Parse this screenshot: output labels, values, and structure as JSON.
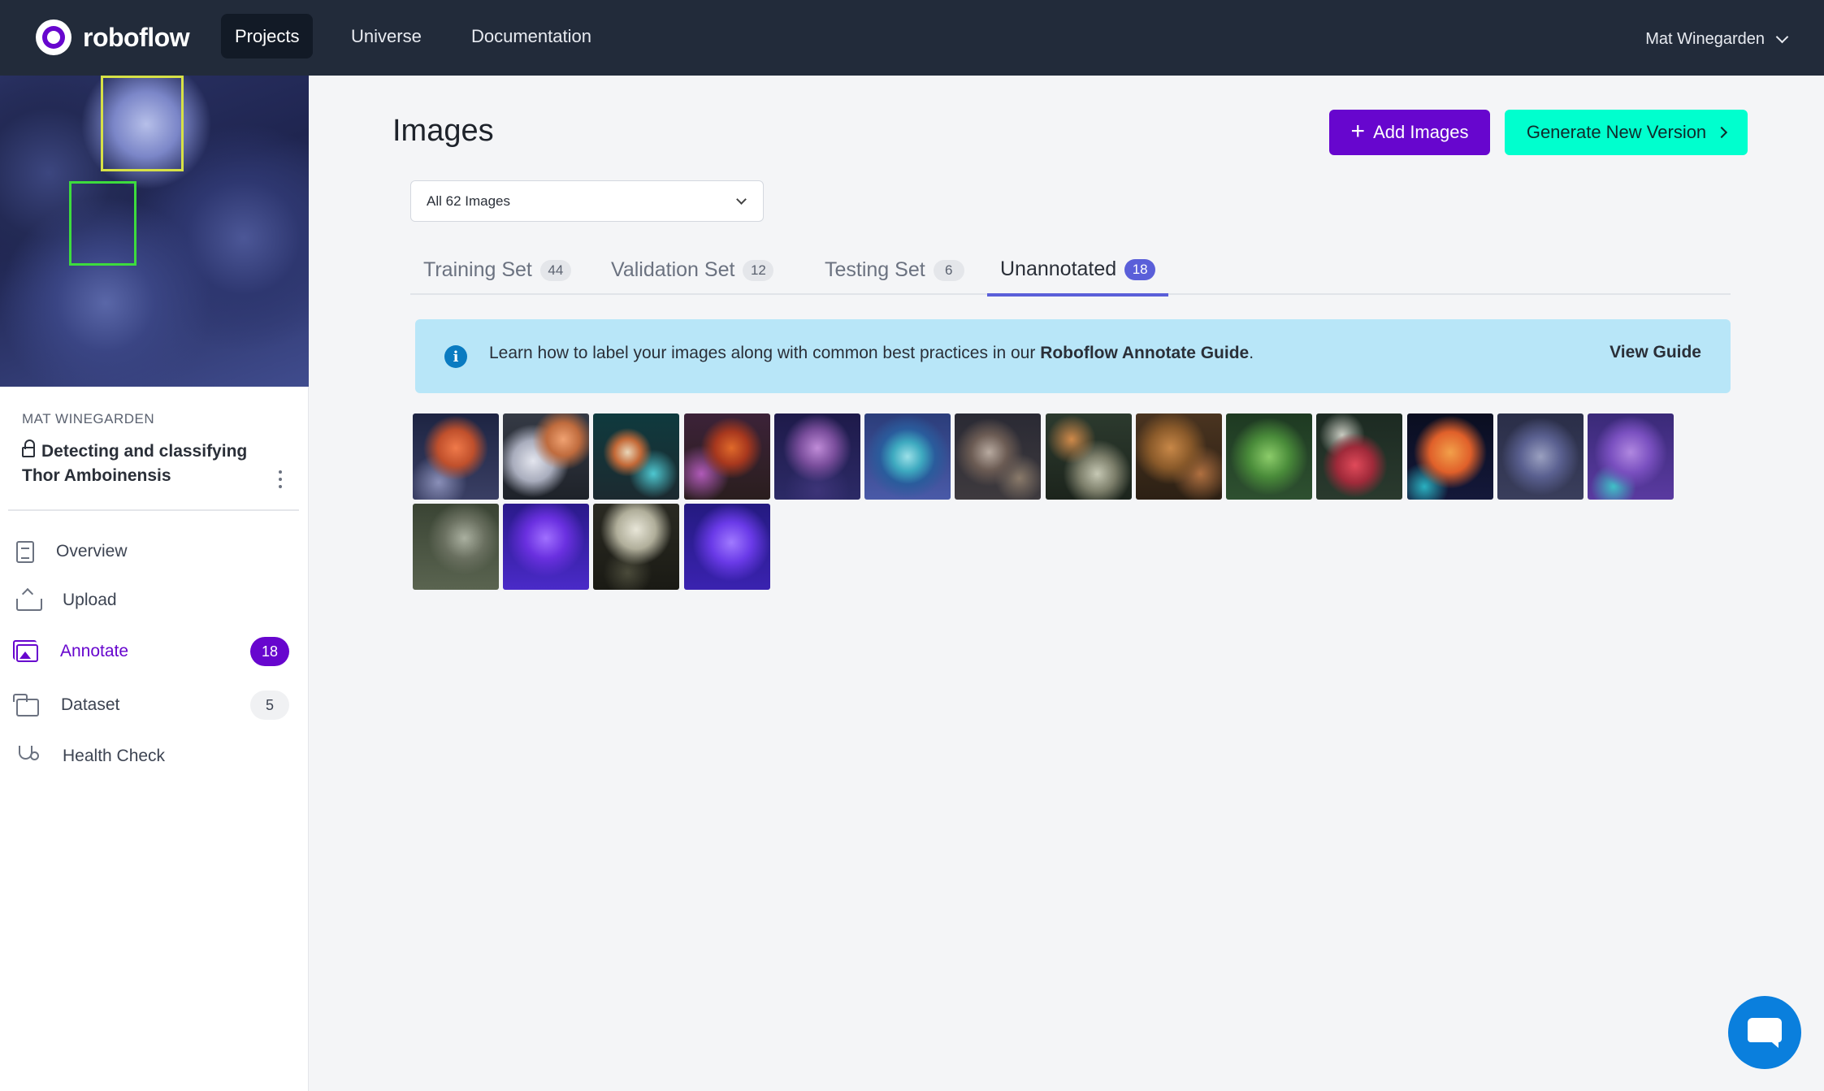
{
  "nav": {
    "brand": "roboflow",
    "items": [
      {
        "label": "Projects",
        "active": true
      },
      {
        "label": "Universe",
        "active": false
      },
      {
        "label": "Documentation",
        "active": false
      }
    ],
    "user": "Mat Winegarden"
  },
  "sidebar": {
    "owner": "MAT WINEGARDEN",
    "project_title": "Detecting and classifying Thor Amboinensis",
    "items": [
      {
        "label": "Overview",
        "icon": "document-icon",
        "badge": null
      },
      {
        "label": "Upload",
        "icon": "upload-icon",
        "badge": null
      },
      {
        "label": "Annotate",
        "icon": "annotate-icon",
        "badge": "18",
        "active": true
      },
      {
        "label": "Dataset",
        "icon": "folder-icon",
        "badge": "5"
      },
      {
        "label": "Health Check",
        "icon": "stethoscope-icon",
        "badge": null
      }
    ]
  },
  "main": {
    "title": "Images",
    "add_images_label": "Add Images",
    "generate_label": "Generate New Version",
    "filter_value": "All 62 Images",
    "tabs": [
      {
        "label": "Training Set",
        "count": "44"
      },
      {
        "label": "Validation Set",
        "count": "12"
      },
      {
        "label": "Testing Set",
        "count": "6"
      },
      {
        "label": "Unannotated",
        "count": "18",
        "active": true
      }
    ],
    "banner": {
      "text_before": "Learn how to label your images along with common best practices in our ",
      "link_text": "Roboflow Annotate Guide",
      "text_after": ".",
      "action": "View Guide"
    }
  },
  "colors": {
    "nav_bg": "#222b3a",
    "brand_purple": "#6706ce",
    "accent_teal": "#00ffce",
    "tab_active": "#5a5fd9",
    "banner_bg": "#b8e6f8",
    "chat_blue": "#0a7fdd"
  }
}
